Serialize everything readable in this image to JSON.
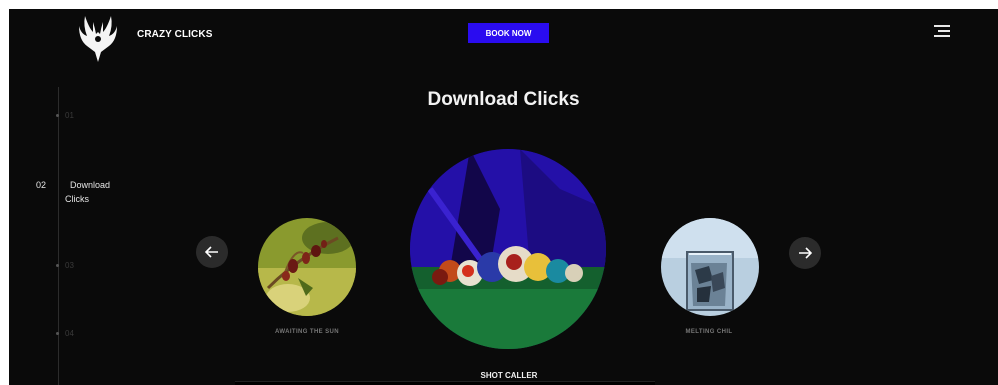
{
  "header": {
    "brand": "CRAZY CLICKS",
    "book_button": "BOOK NOW",
    "icons": [
      "phoenix-logo-icon",
      "hamburger-menu-icon"
    ]
  },
  "page": {
    "title": "Download Clicks"
  },
  "side_nav": {
    "items": [
      {
        "number": "01",
        "label": ""
      },
      {
        "number": "02",
        "label_line1": "Download",
        "label_line2": "Clicks",
        "active": true
      },
      {
        "number": "03",
        "label": ""
      },
      {
        "number": "04",
        "label": ""
      }
    ]
  },
  "carousel": {
    "prev_icon": "arrow-left-icon",
    "next_icon": "arrow-right-icon",
    "slides": [
      {
        "caption": "AWAITING THE SUN",
        "image": "plant-buds-photo"
      },
      {
        "caption": "SHOT CALLER",
        "image": "billiard-balls-photo",
        "active": true
      },
      {
        "caption": "MELTING CHIL",
        "image": "ice-glass-photo"
      }
    ]
  },
  "colors": {
    "background": "#0a0a0a",
    "accent": "#2a0cf0",
    "text": "#ffffff"
  }
}
